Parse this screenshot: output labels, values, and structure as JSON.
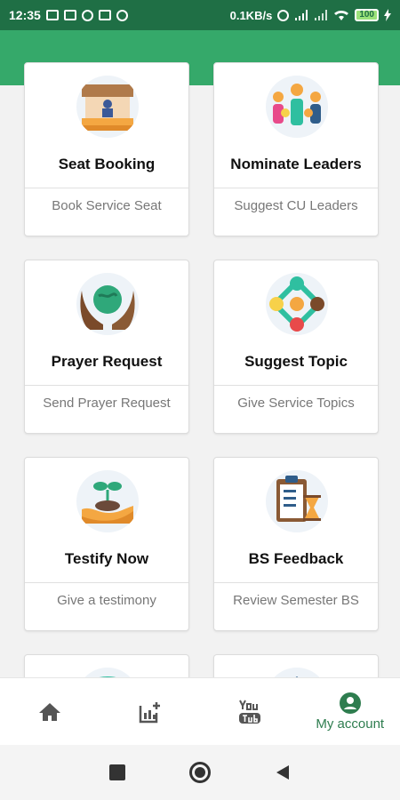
{
  "status_bar": {
    "time": "12:35",
    "network_speed": "0.1KB/s",
    "battery": "100"
  },
  "cards": [
    {
      "title": "Seat Booking",
      "subtitle": "Book Service Seat",
      "icon": "seat-booking-icon"
    },
    {
      "title": "Nominate Leaders",
      "subtitle": "Suggest CU Leaders",
      "icon": "people-icon"
    },
    {
      "title": "Prayer Request",
      "subtitle": "Send Prayer Request",
      "icon": "hands-globe-icon"
    },
    {
      "title": "Suggest Topic",
      "subtitle": "Give Service Topics",
      "icon": "network-icon"
    },
    {
      "title": "Testify Now",
      "subtitle": "Give a testimony",
      "icon": "sprout-hand-icon"
    },
    {
      "title": "BS Feedback",
      "subtitle": "Review Semester BS",
      "icon": "clipboard-hourglass-icon"
    }
  ],
  "bottom_nav": [
    {
      "icon": "home-icon",
      "label": ""
    },
    {
      "icon": "add-chart-icon",
      "label": ""
    },
    {
      "icon": "youtube-icon",
      "label": ""
    },
    {
      "icon": "account-icon",
      "label": "My account"
    }
  ],
  "colors": {
    "status_bar": "#1f6f45",
    "header": "#35a96a",
    "accent": "#2e7d4f"
  }
}
